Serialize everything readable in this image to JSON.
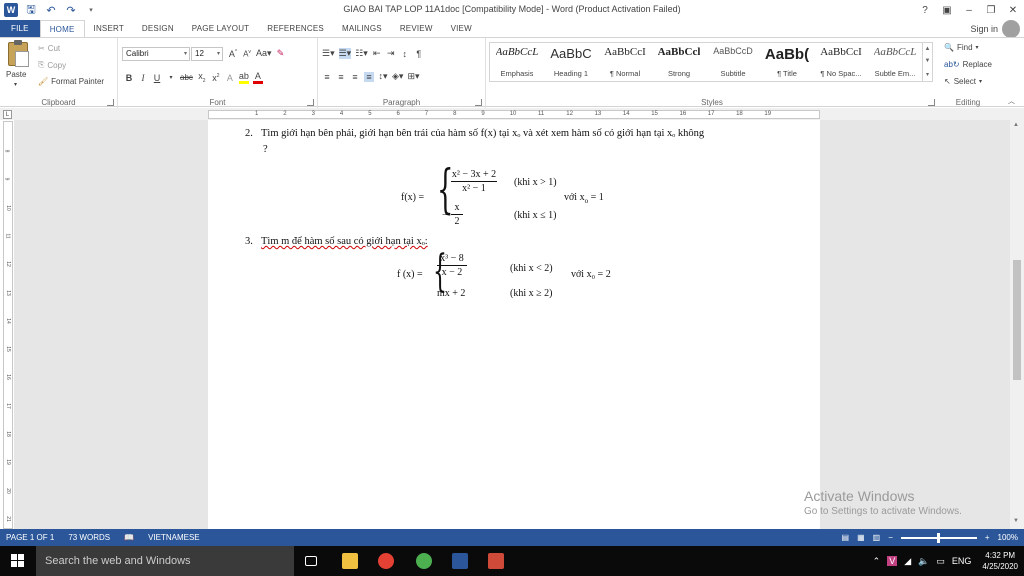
{
  "window": {
    "title": "GIAO BAI TAP LOP 11A1doc [Compatibility Mode] - Word (Product Activation Failed)",
    "controls": [
      "?",
      "▣",
      "–",
      "❐",
      "✕"
    ]
  },
  "tabs": [
    "FILE",
    "HOME",
    "INSERT",
    "DESIGN",
    "PAGE LAYOUT",
    "REFERENCES",
    "MAILINGS",
    "REVIEW",
    "VIEW"
  ],
  "signin": "Sign in",
  "clipboard": {
    "paste": "Paste",
    "cut": "Cut",
    "copy": "Copy",
    "format_painter": "Format Painter",
    "label": "Clipboard"
  },
  "font": {
    "name": "Calibri",
    "size": "12",
    "label": "Font"
  },
  "paragraph": {
    "label": "Paragraph"
  },
  "styles": {
    "label": "Styles",
    "items": [
      {
        "preview": "AaBbCcL",
        "name": "Emphasis"
      },
      {
        "preview": "AaBbC",
        "name": "Heading 1"
      },
      {
        "preview": "AaBbCcI",
        "name": "¶ Normal"
      },
      {
        "preview": "AaBbCcl",
        "name": "Strong"
      },
      {
        "preview": "AaBbCcD",
        "name": "Subtitle"
      },
      {
        "preview": "AaBb(",
        "name": "¶ Title"
      },
      {
        "preview": "AaBbCcI",
        "name": "¶ No Spac..."
      },
      {
        "preview": "AaBbCcL",
        "name": "Subtle Em..."
      }
    ]
  },
  "editing": {
    "find": "Find",
    "replace": "Replace",
    "select": "Select",
    "label": "Editing"
  },
  "ruler_numbers": [
    "1",
    "2",
    "3",
    "4",
    "5",
    "6",
    "7",
    "8",
    "9",
    "10",
    "11",
    "12",
    "13",
    "14",
    "15",
    "16",
    "17",
    "18",
    "19"
  ],
  "vruler_numbers": [
    "8",
    "9",
    "10",
    "11",
    "12",
    "13",
    "14",
    "15",
    "16",
    "17",
    "18",
    "19",
    "20",
    "21"
  ],
  "document": {
    "q2_num": "2.",
    "q2_text": "Tìm giới hạn bên phải, giới hạn bên trái của hàm số f(x) tại  xₒ và xét xem hàm số có giới hạn tại xₒ không",
    "q2_cont": "?",
    "f1_lhs": "f(x) =",
    "f1_case1_num": "x² − 3x + 2",
    "f1_case1_den": "x² − 1",
    "f1_case1_cond": "(khi x > 1)",
    "f1_case2_sign": "−",
    "f1_case2_num": "x",
    "f1_case2_den": "2",
    "f1_case2_cond": "(khi x ≤ 1)",
    "f1_at": "với  x",
    "f1_at_sub": "o",
    "f1_at_val": " = 1",
    "q3_num": "3.",
    "q3_text": "Tìm m để hàm số sau có giới hạn tại xₒ:",
    "f2_lhs": "f (x) =",
    "f2_case1_num": "x³ − 8",
    "f2_case1_den": "x − 2",
    "f2_case1_cond": "(khi x < 2)",
    "f2_case2": "mx + 2",
    "f2_case2_cond": "(khi x ≥ 2)",
    "f2_at": "với x₀ = 2"
  },
  "watermark": {
    "line1": "Activate Windows",
    "line2": "Go to Settings to activate Windows."
  },
  "status": {
    "page": "PAGE 1 OF 1",
    "words": "73 WORDS",
    "language": "VIETNAMESE",
    "zoom": "100%"
  },
  "taskbar": {
    "search_placeholder": "Search the web and Windows",
    "lang": "ENG",
    "time": "4:32 PM",
    "date": "4/25/2020"
  }
}
